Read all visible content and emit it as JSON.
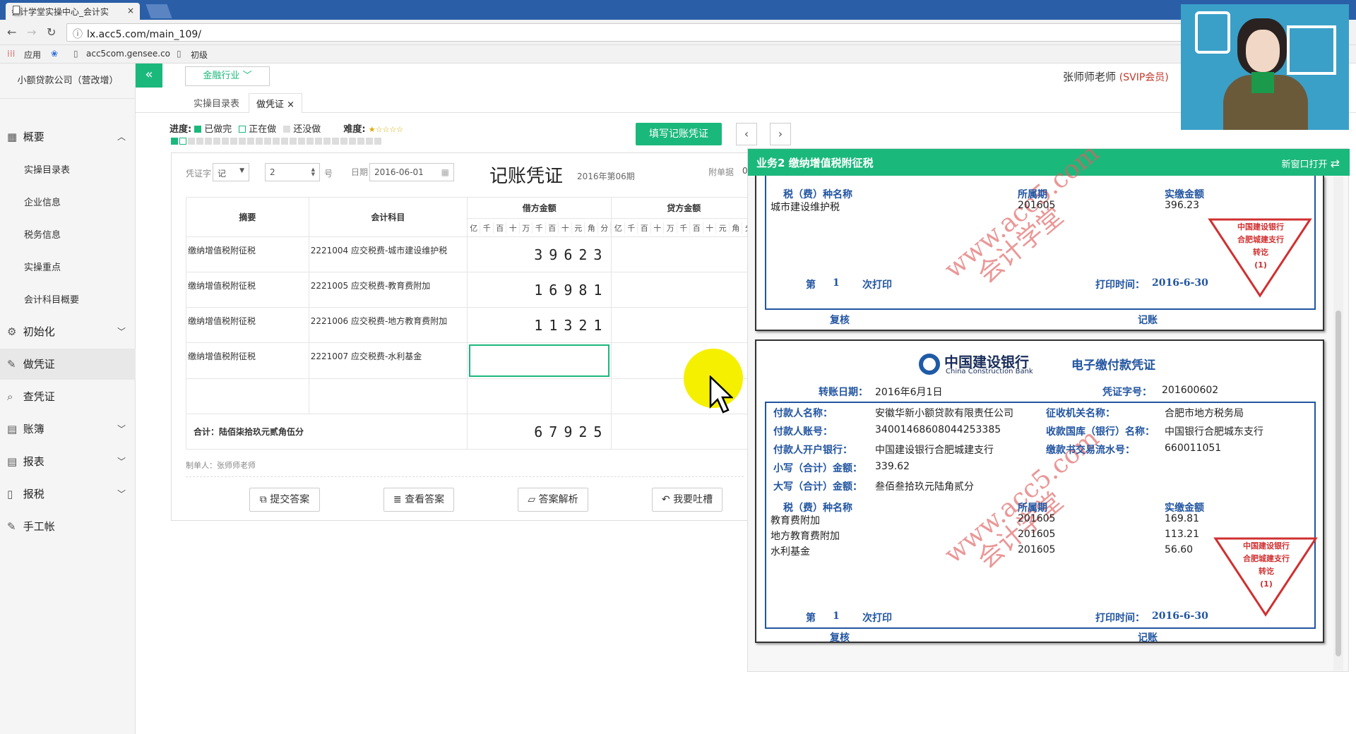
{
  "browser": {
    "tab_title": "会计学堂实操中心_会计实",
    "tab_close": "×",
    "url": "lx.acc5.com/main_109/",
    "bookmarks": [
      "应用",
      "acc5com.gensee.co",
      "初级"
    ]
  },
  "app": {
    "collapse_icon": "«",
    "industry": "金融行业",
    "user_name": "张师师老师",
    "user_badge": "(SVIP会员)"
  },
  "sidebar": {
    "company": "小额贷款公司（营改增）",
    "items": [
      {
        "icon": "▦",
        "label": "概要",
        "chev": "︿"
      },
      {
        "icon": "⚙",
        "label": "初始化",
        "chev": "﹀"
      },
      {
        "icon": "✎",
        "label": "做凭证",
        "chev": ""
      },
      {
        "icon": "⌕",
        "label": "查凭证",
        "chev": ""
      },
      {
        "icon": "▤",
        "label": "账簿",
        "chev": "﹀"
      },
      {
        "icon": "▤",
        "label": "报表",
        "chev": "﹀"
      },
      {
        "icon": "▯",
        "label": "报税",
        "chev": "﹀"
      },
      {
        "icon": "✎",
        "label": "手工帐",
        "chev": ""
      }
    ],
    "sub_items": [
      "实操目录表",
      "企业信息",
      "税务信息",
      "实操重点",
      "会计科目概要"
    ]
  },
  "subtabs": {
    "tab1": "实操目录表",
    "tab2": "做凭证",
    "tab2_close": "×"
  },
  "progress": {
    "label": "进度:",
    "done": "已做完",
    "doing": "正在做",
    "todo": "还没做",
    "difficulty_label": "难度:",
    "difficulty_stars": "★☆☆☆☆",
    "done_count": 1,
    "total": 25
  },
  "fill_button": "填写记账凭证",
  "nav_prev": "‹",
  "nav_next": "›",
  "voucher": {
    "word_label": "凭证字",
    "word_value": "记",
    "number_value": "2",
    "number_suffix": "号",
    "date_label": "日期",
    "date_value": "2016-06-01",
    "title": "记账凭证",
    "period": "2016年第06期",
    "attach_label": "附单据",
    "attach_value": "0",
    "col_summary": "摘要",
    "col_account": "会计科目",
    "col_debit": "借方金额",
    "col_credit": "贷方金额",
    "units": [
      "亿",
      "千",
      "百",
      "十",
      "万",
      "千",
      "百",
      "十",
      "元",
      "角",
      "分"
    ],
    "rows": [
      {
        "summary": "缴纳增值税附征税",
        "account": "2221004 应交税费-城市建设维护税",
        "debit": "39623"
      },
      {
        "summary": "缴纳增值税附征税",
        "account": "2221005 应交税费-教育费附加",
        "debit": "16981"
      },
      {
        "summary": "缴纳增值税附征税",
        "account": "2221006 应交税费-地方教育费附加",
        "debit": "11321"
      },
      {
        "summary": "缴纳增值税附征税",
        "account": "2221007 应交税费-水利基金",
        "debit": ""
      },
      {
        "summary": "",
        "account": "",
        "debit": ""
      }
    ],
    "total_label": "合计：陆佰柒拾玖元贰角伍分",
    "total_debit": "67925",
    "maker": "制单人：张师师老师",
    "buttons": [
      "提交答案",
      "查看答案",
      "答案解析",
      "我要吐槽"
    ]
  },
  "panel": {
    "title": "业务2 缴纳增值税附征税",
    "open_new": "新窗口打开",
    "doc1": {
      "tax_name_label": "税（费）种名称",
      "period_label": "所属期",
      "amount_label": "实缴金额",
      "tax_name": "城市建设维护税",
      "period": "201605",
      "amount": "396.23",
      "print_no_label": "第",
      "print_no": "1",
      "print_suffix": "次打印",
      "print_time_label": "打印时间：",
      "print_time": "2016-6-30",
      "review": "复核",
      "bookkeep": "记账"
    },
    "doc2": {
      "bank_name": "中国建设银行",
      "bank_en": "China Construction Bank",
      "title": "电子缴付款凭证",
      "transfer_date_label": "转账日期：",
      "transfer_date": "2016年6月1日",
      "voucher_no_label": "凭证字号：",
      "voucher_no": "201600602",
      "payer_name_label": "付款人名称：",
      "payer_name": "安徽华新小额贷款有限责任公司",
      "collector_label": "征收机关名称：",
      "collector": "合肥市地方税务局",
      "payer_account_label": "付款人账号：",
      "payer_account": "34001468608044253385",
      "treasury_label": "收款国库（银行）名称：",
      "treasury": "中国银行合肥城东支行",
      "payer_bank_label": "付款人开户银行：",
      "payer_bank": "中国建设银行合肥城建支行",
      "serial_label": "缴款书交易流水号：",
      "serial": "660011051",
      "small_total_label": "小写（合计）金额：",
      "small_total": "339.62",
      "big_total_label": "大写（合计）金额：",
      "big_total": "叁佰叁拾玖元陆角贰分",
      "tax_name_label": "税（费）种名称",
      "period_label": "所属期",
      "amount_label": "实缴金额",
      "items": [
        {
          "name": "教育费附加",
          "period": "201605",
          "amount": "169.81"
        },
        {
          "name": "地方教育费附加",
          "period": "201605",
          "amount": "113.21"
        },
        {
          "name": "水利基金",
          "period": "201605",
          "amount": "56.60"
        }
      ],
      "print_no_label": "第",
      "print_no": "1",
      "print_suffix": "次打印",
      "print_time_label": "打印时间：",
      "print_time": "2016-6-30",
      "review": "复核",
      "bookkeep": "记账"
    },
    "stamp": [
      "中国建设银行",
      "合肥城建支行",
      "转讫",
      "(1)"
    ],
    "watermark": [
      "www.acc5.com",
      "会计学堂"
    ]
  }
}
